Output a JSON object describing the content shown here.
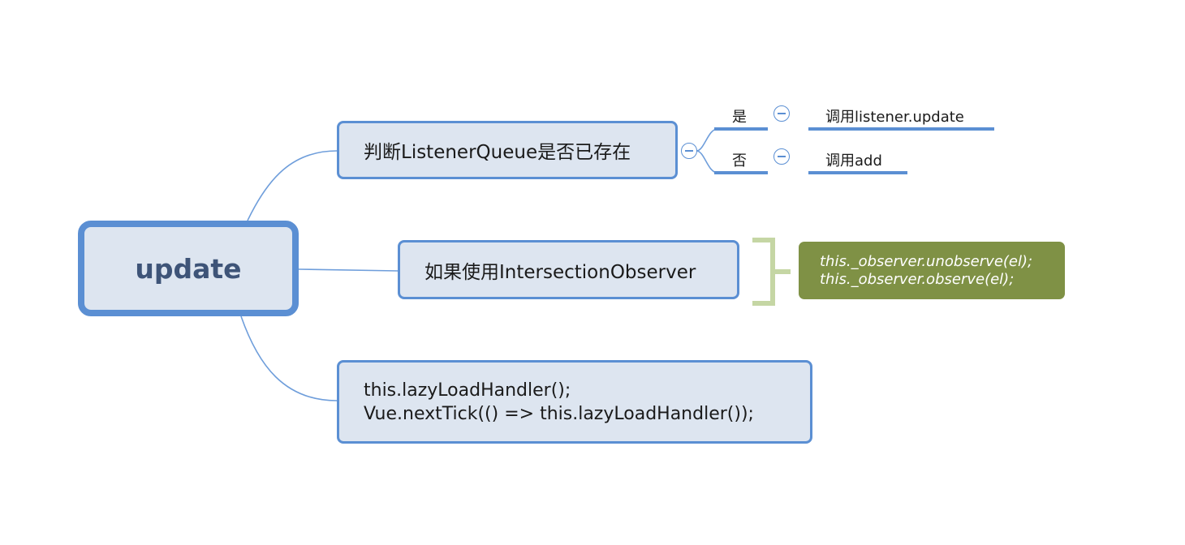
{
  "root": {
    "label": "update"
  },
  "branches": {
    "check": {
      "label": "判断ListenerQueue是否已存在",
      "yes": {
        "condition": "是",
        "action": "调用listener.update"
      },
      "no": {
        "condition": "否",
        "action": "调用add"
      }
    },
    "observer": {
      "label": "如果使用IntersectionObserver",
      "note_lines": [
        "this._observer.unobserve(el);",
        "this._observer.observe(el);"
      ]
    },
    "handler": {
      "lines": [
        "this.lazyLoadHandler();",
        "Vue.nextTick(() => this.lazyLoadHandler());"
      ]
    }
  },
  "colors": {
    "node_fill": "#dde5f0",
    "node_border": "#5b8fd3",
    "root_text": "#3e5478",
    "note_fill": "#7f9145",
    "bracket": "#c5d6a4"
  },
  "icons": {
    "collapse": "minus-circle-icon"
  }
}
